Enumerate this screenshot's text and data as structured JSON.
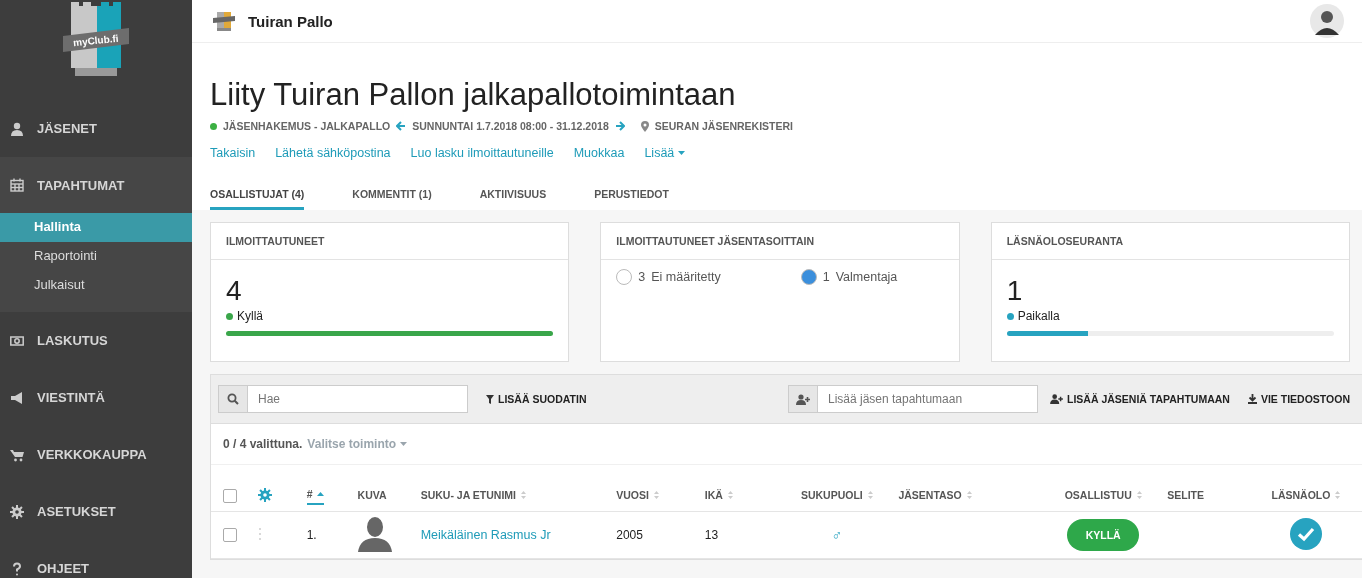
{
  "sidebar": {
    "logo_text": "myClub.fi",
    "items": [
      {
        "label": "JÄSENET",
        "expanded": false
      },
      {
        "label": "TAPAHTUMAT",
        "expanded": true,
        "children": [
          {
            "label": "Hallinta",
            "selected": true
          },
          {
            "label": "Raportointi",
            "selected": false
          },
          {
            "label": "Julkaisut",
            "selected": false
          }
        ]
      },
      {
        "label": "LASKUTUS",
        "expanded": false
      },
      {
        "label": "VIESTINTÄ",
        "expanded": false
      },
      {
        "label": "VERKKOKAUPPA",
        "expanded": false
      },
      {
        "label": "ASETUKSET",
        "expanded": false
      },
      {
        "label": "OHJEET",
        "expanded": false
      }
    ]
  },
  "header": {
    "club_name": "Tuiran Pallo"
  },
  "event": {
    "title": "Liity Tuiran Pallon jalkapallotoimintaan",
    "type": "JÄSENHAKEMUS - JALKAPALLO",
    "date": "SUNNUNTAI 1.7.2018 08:00 - 31.12.2018",
    "location": "SEURAN JÄSENREKISTERI",
    "actions": [
      {
        "label": "Takaisin",
        "dropdown": false
      },
      {
        "label": "Lähetä sähköpostina",
        "dropdown": false
      },
      {
        "label": "Luo lasku ilmoittautuneille",
        "dropdown": false
      },
      {
        "label": "Muokkaa",
        "dropdown": false
      },
      {
        "label": "Lisää",
        "dropdown": true
      }
    ]
  },
  "tabs": [
    {
      "label": "OSALLISTUJAT (4)",
      "selected": true
    },
    {
      "label": "KOMMENTIT (1)",
      "selected": false
    },
    {
      "label": "AKTIIVISUUS",
      "selected": false
    },
    {
      "label": "PERUSTIEDOT",
      "selected": false
    }
  ],
  "cards": [
    {
      "kind": "count",
      "title": "ILMOITTAUTUNEET",
      "value": "4",
      "legend": "Kyllä",
      "color": "#3aa64a",
      "level": 1.0
    },
    {
      "kind": "levels",
      "title": "ILMOITTAUTUNEET JÄSENTASOITTAIN",
      "items": [
        {
          "count": "3",
          "label": "Ei määritetty",
          "color": "#ffffff"
        },
        {
          "count": "1",
          "label": "Valmentaja",
          "color": "#3b8fdc"
        }
      ]
    },
    {
      "kind": "count",
      "title": "LÄSNÄOLOSEURANTA",
      "value": "1",
      "legend": "Paikalla",
      "color": "#27a3c0",
      "level": 0.25
    }
  ],
  "toolbar": {
    "search_placeholder": "Hae",
    "filter_button": "LISÄÄ SUODATIN",
    "add_member_placeholder": "Lisää jäsen tapahtumaan",
    "add_members_button": "LISÄÄ JÄSENIÄ TAPAHTUMAAN",
    "export_button": "VIE TIEDOSTOON"
  },
  "selection": {
    "count": "0 / 4 valittuna.",
    "action": "Valitse toiminto"
  },
  "table": {
    "all_selected": false,
    "columns": [
      {
        "label": "#",
        "sortable": true,
        "sorted": true
      },
      {
        "label": "KUVA",
        "sortable": false,
        "sorted": false
      },
      {
        "label": "SUKU- JA ETUNIMI",
        "sortable": true,
        "sorted": false
      },
      {
        "label": "VUOSI",
        "sortable": true,
        "sorted": false
      },
      {
        "label": "IKÄ",
        "sortable": true,
        "sorted": false
      },
      {
        "label": "SUKUPUOLI",
        "sortable": true,
        "sorted": false
      },
      {
        "label": "JÄSENTASO",
        "sortable": true,
        "sorted": false
      },
      {
        "label": "OSALLISTUU",
        "sortable": true,
        "sorted": false
      },
      {
        "label": "SELITE",
        "sortable": false,
        "sorted": false
      },
      {
        "label": "LÄSNÄOLO",
        "sortable": true,
        "sorted": false
      }
    ],
    "rows": [
      {
        "checked": false,
        "number": "1.",
        "name": "Meikäläinen Rasmus Jr",
        "year": "2005",
        "age": "13",
        "gender": "♂",
        "participates": "KYLLÄ",
        "present": true
      }
    ]
  }
}
